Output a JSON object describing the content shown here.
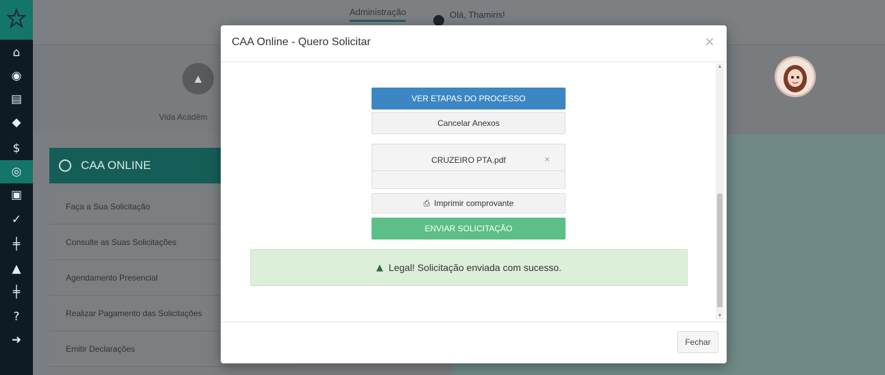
{
  "header": {
    "admin_tab": "Administração",
    "greeting": "Olá, Thamiris!"
  },
  "sidebar": {
    "icons": [
      {
        "name": "home-icon",
        "glyph": "⌂"
      },
      {
        "name": "user-icon",
        "glyph": "◉"
      },
      {
        "name": "document-icon",
        "glyph": "▤"
      },
      {
        "name": "graduation-icon",
        "glyph": "◆"
      },
      {
        "name": "dollar-icon",
        "glyph": "$"
      },
      {
        "name": "caa-icon",
        "glyph": "◎"
      },
      {
        "name": "id-card-icon",
        "glyph": "▣"
      },
      {
        "name": "check-circle-icon",
        "glyph": "✓"
      },
      {
        "name": "signpost-icon",
        "glyph": "╪"
      },
      {
        "name": "bell-icon",
        "glyph": "▲"
      },
      {
        "name": "signpost-icon",
        "glyph": "╪"
      },
      {
        "name": "help-icon",
        "glyph": "?"
      },
      {
        "name": "logout-icon",
        "glyph": "➜"
      }
    ],
    "active_index": 5
  },
  "background": {
    "card_label": "Vida Acadêm",
    "section_title": "CAA ONLINE",
    "menu_items": [
      "Faça a Sua Solicitação",
      "Consulte as Suas Solicitações",
      "Agendamento Presencial",
      "Realizar Pagamento das Solicitações",
      "Emitir Declarações"
    ]
  },
  "modal": {
    "title": "CAA Online - Quero Solicitar",
    "close_glyph": "×",
    "steps_button": "VER ETAPAS DO PROCESSO",
    "cancel_attachments_button": "Cancelar Anexos",
    "attached_file": "CRUZEIRO PTA.pdf",
    "remove_file_glyph": "×",
    "print_button": "Imprimir comprovante",
    "send_button": "ENVIAR SOLICITAÇÃO",
    "success_message": "Legal! Solicitação enviada com sucesso.",
    "footer_close_button": "Fechar"
  },
  "colors": {
    "brand_teal": "#14756a",
    "primary_blue": "#3c86c4",
    "success_green": "#5cbf87",
    "alert_bg": "#dcefd8"
  }
}
